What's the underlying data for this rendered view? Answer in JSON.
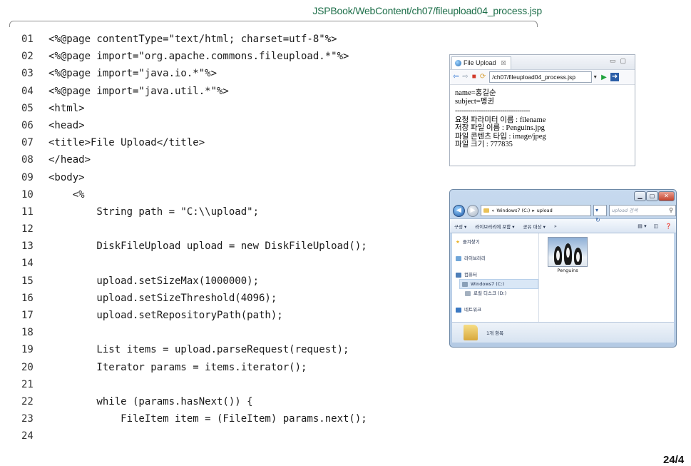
{
  "header": {
    "file_path": "JSPBook/WebContent/ch07/fileupload04_process.jsp"
  },
  "code_lines": [
    {
      "num": "01",
      "text": "<%@page contentType=\"text/html; charset=utf-8\"%>"
    },
    {
      "num": "02",
      "text": "<%@page import=\"org.apache.commons.fileupload.*\"%>"
    },
    {
      "num": "03",
      "text": "<%@page import=\"java.io.*\"%>"
    },
    {
      "num": "04",
      "text": "<%@page import=\"java.util.*\"%>"
    },
    {
      "num": "05",
      "text": "<html>"
    },
    {
      "num": "06",
      "text": "<head>"
    },
    {
      "num": "07",
      "text": "<title>File Upload</title>"
    },
    {
      "num": "08",
      "text": "</head>"
    },
    {
      "num": "09",
      "text": "<body>"
    },
    {
      "num": "10",
      "text": "    <%"
    },
    {
      "num": "11",
      "text": "        String path = \"C:\\\\upload\";"
    },
    {
      "num": "12",
      "text": ""
    },
    {
      "num": "13",
      "text": "        DiskFileUpload upload = new DiskFileUpload();"
    },
    {
      "num": "14",
      "text": ""
    },
    {
      "num": "15",
      "text": "        upload.setSizeMax(1000000);"
    },
    {
      "num": "16",
      "text": "        upload.setSizeThreshold(4096);"
    },
    {
      "num": "17",
      "text": "        upload.setRepositoryPath(path);"
    },
    {
      "num": "18",
      "text": ""
    },
    {
      "num": "19",
      "text": "        List items = upload.parseRequest(request);"
    },
    {
      "num": "20",
      "text": "        Iterator params = items.iterator();"
    },
    {
      "num": "21",
      "text": ""
    },
    {
      "num": "22",
      "text": "        while (params.hasNext()) {"
    },
    {
      "num": "23",
      "text": "            FileItem item = (FileItem) params.next();"
    },
    {
      "num": "24",
      "text": ""
    }
  ],
  "browser": {
    "tab_label": "File Upload",
    "tab_close": "☒",
    "url": "/ch07/fileupload04_process.jsp",
    "content": {
      "name_line": "name=홍길순",
      "subject_line": "subject=펭귄",
      "separator": "-----------------------------------",
      "param_line": "요청 파라미터 이름 : filename",
      "saved_line": "저장 파일 이름 : Penguins.jpg",
      "type_line": "파일 콘텐츠 타입 : image/jpeg",
      "size_line": "파일 크기 : 777835"
    }
  },
  "explorer": {
    "address_prefix": "«",
    "address_drive": "Windows7 (C:)",
    "address_sep": "▸",
    "address_folder": "upload",
    "search_placeholder": "upload 검색",
    "toolbar": {
      "organize": "구성 ▾",
      "include_library": "라이브러리에 포함 ▾",
      "share": "공유 대상 ▾",
      "more": "»"
    },
    "nav": {
      "favorites": "즐겨찾기",
      "libraries": "라이브러리",
      "computer": "컴퓨터",
      "drive_c": "Windows7 (C:)",
      "drive_d": "로컬 디스크 (D:)",
      "network": "네트워크"
    },
    "file_name": "Penguins",
    "status": "1개 항목"
  },
  "footer": {
    "page_number": "24/4"
  }
}
